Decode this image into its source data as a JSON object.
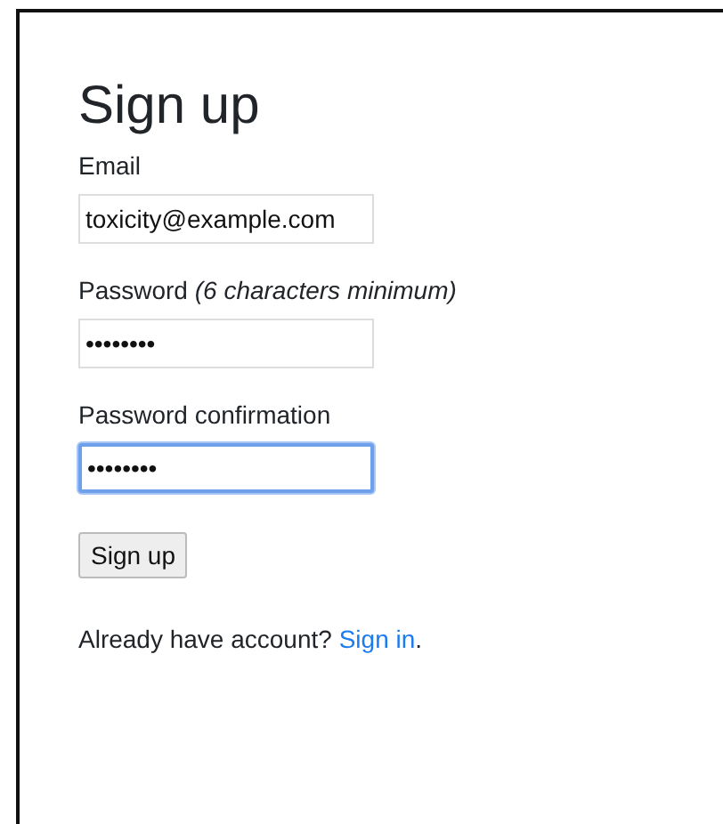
{
  "title": "Sign up",
  "fields": [
    {
      "label": "Email",
      "value": "toxicity@example.com",
      "focused": false
    },
    {
      "label": "Password *(6 characters minimum)*",
      "value": "••••••••",
      "focused": false
    },
    {
      "label": "Password confirmation",
      "value": "••••••••",
      "focused": true
    }
  ],
  "submit_button": "Sign up",
  "footer": {
    "text": "Already have account? ",
    "link": "Sign in",
    "after": "."
  }
}
